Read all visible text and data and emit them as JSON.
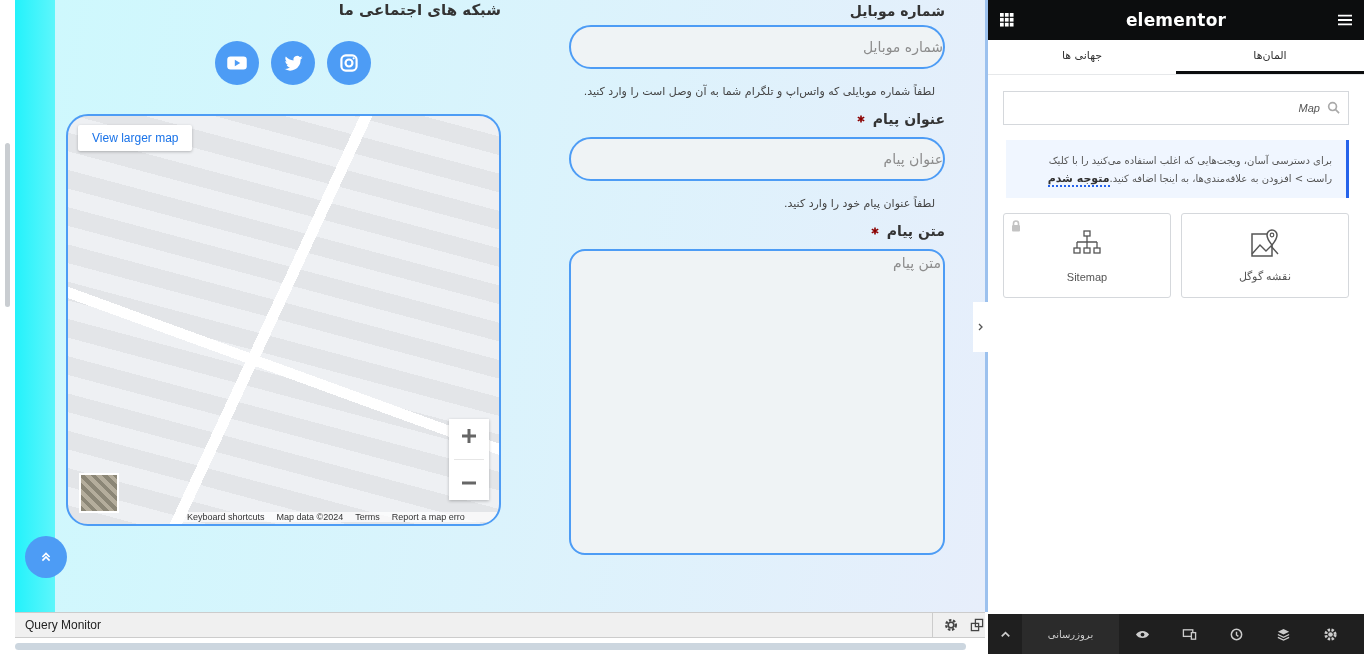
{
  "preview": {
    "social": {
      "heading": "شبکه های اجتماعی ما",
      "links": [
        {
          "kind": "youtube"
        },
        {
          "kind": "twitter"
        },
        {
          "kind": "instagram"
        }
      ]
    },
    "map": {
      "view_larger": "View larger map",
      "attribution": {
        "shortcuts": "Keyboard shortcuts",
        "map_data": "Map data ©2024",
        "terms": "Terms",
        "report": "Report a map erro"
      }
    },
    "form": {
      "fields": [
        {
          "kind": "input",
          "label": "شماره موبایل",
          "required": false,
          "placeholder": "شماره موبایل",
          "help": "لطفاً شماره موبایلی که واتس‌اپ و تلگرام شما به آن وصل است را وارد کنید."
        },
        {
          "kind": "input",
          "label": "عنوان پیام",
          "required": true,
          "placeholder": "عنوان پیام",
          "help": "لطفاً عنوان پیام خود را وارد کنید."
        },
        {
          "kind": "textarea",
          "label": "متن پیام",
          "required": true,
          "placeholder": "متن پیام"
        }
      ]
    }
  },
  "query_monitor": {
    "label": "Query Monitor"
  },
  "panel": {
    "brand": "elementor",
    "tabs": [
      {
        "label": "المان‌ها",
        "selected": true
      },
      {
        "label": "جهانی ها",
        "selected": false
      }
    ],
    "search": {
      "value": "Map"
    },
    "notice": {
      "text": "برای دسترسی آسان، ویجت‌هایی که اغلب استفاده می‌کنید را با کلیک راست > افزودن به علاقه‌مندی‌ها، به اینجا اضافه کنید.",
      "link": "متوجه شدم"
    },
    "widgets": [
      {
        "kind": "map",
        "label": "نقشه گوگل",
        "locked": false
      },
      {
        "kind": "sitemap",
        "label": "Sitemap",
        "locked": true
      }
    ],
    "footer": {
      "update": "بروزرسانی"
    }
  }
}
